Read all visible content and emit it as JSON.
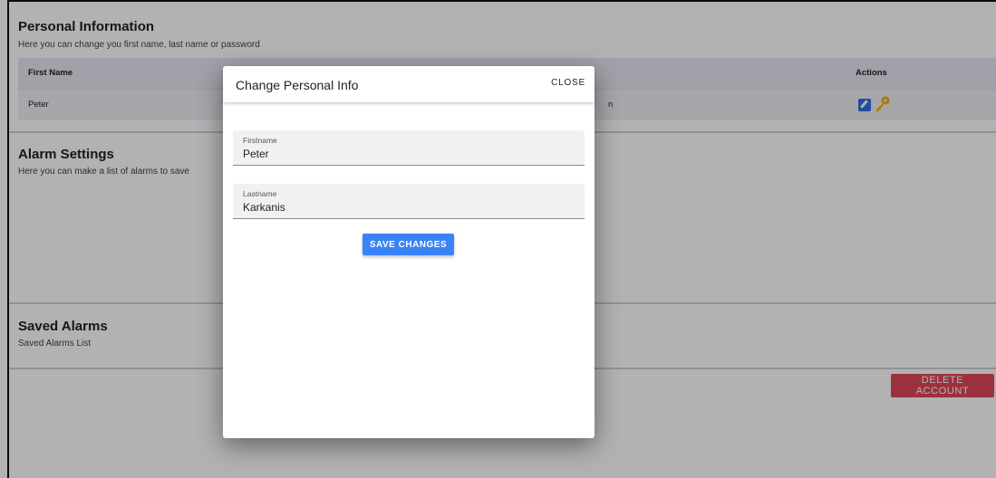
{
  "personal": {
    "title": "Personal Information",
    "subtitle": "Here you can change you first name, last name or password",
    "table": {
      "headers": {
        "first_name": "First Name",
        "actions": "Actions"
      },
      "row": {
        "first_name": "Peter",
        "partial": "n"
      },
      "action_icons": [
        "edit-icon",
        "key-icon"
      ]
    }
  },
  "alarm_settings": {
    "title": "Alarm Settings",
    "subtitle": "Here you can make a list of alarms to save"
  },
  "saved_alarms": {
    "title": "Saved Alarms",
    "subtitle": "Saved Alarms List"
  },
  "delete_account_label": "DELETE ACCOUNT",
  "dialog": {
    "title": "Change Personal Info",
    "close_label": "CLOSE",
    "firstname": {
      "label": "Firstname",
      "value": "Peter"
    },
    "lastname": {
      "label": "Lastname",
      "value": "Karkanis"
    },
    "save_label": "SAVE CHANGES"
  },
  "colors": {
    "accent": "#3a82f7",
    "danger": "#e0475a",
    "key": "#f2b400",
    "table_bg": "#efeef5"
  }
}
